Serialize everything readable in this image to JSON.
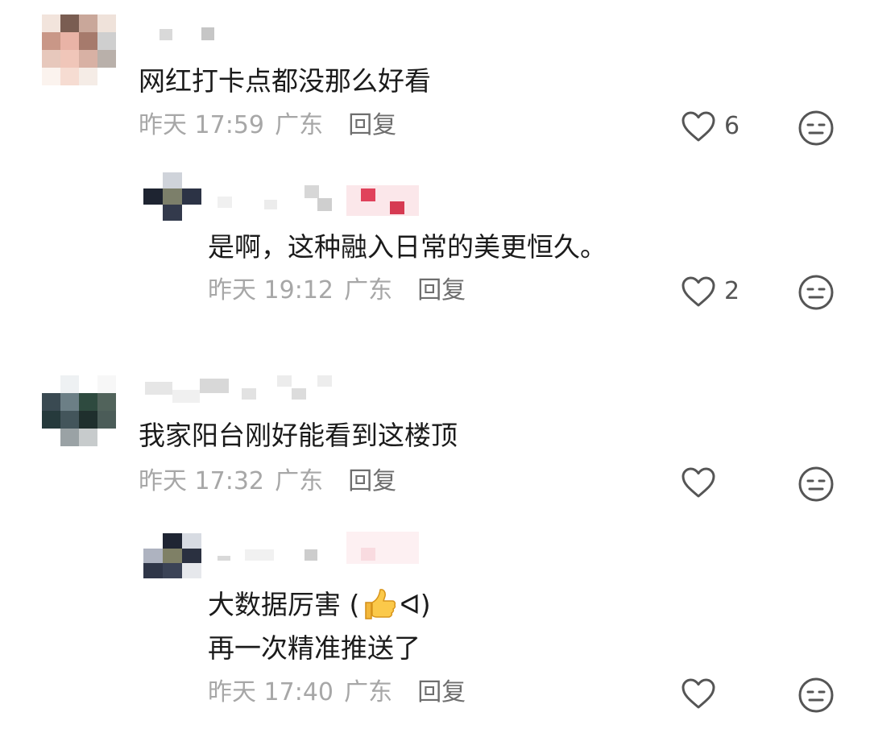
{
  "comments": [
    {
      "text": "网红打卡点都没那么好看",
      "time": "昨天 17:59",
      "location": "广东",
      "reply_label": "回复",
      "likes": "6",
      "reply": {
        "text": "是啊，这种融入日常的美更恒久。",
        "time": "昨天 19:12",
        "location": "广东",
        "reply_label": "回复",
        "likes": "2"
      }
    },
    {
      "text": "我家阳台刚好能看到这楼顶",
      "time": "昨天 17:32",
      "location": "广东",
      "reply_label": "回复",
      "likes": "",
      "reply": {
        "text_line1": "大数据厉害 (",
        "text_line1_end": "ᐊ)",
        "text_line2": "再一次精准推送了",
        "time": "昨天 17:40",
        "location": "广东",
        "reply_label": "回复",
        "likes": ""
      }
    }
  ],
  "icons": {
    "like": "heart-outline-icon",
    "dislike": "neutral-face-icon",
    "emoji": "thumbs-up-emoji"
  },
  "colors": {
    "text": "#1b1b1b",
    "meta": "#a7a7a7",
    "icon": "#555555",
    "name_highlight": "#e0425b"
  }
}
